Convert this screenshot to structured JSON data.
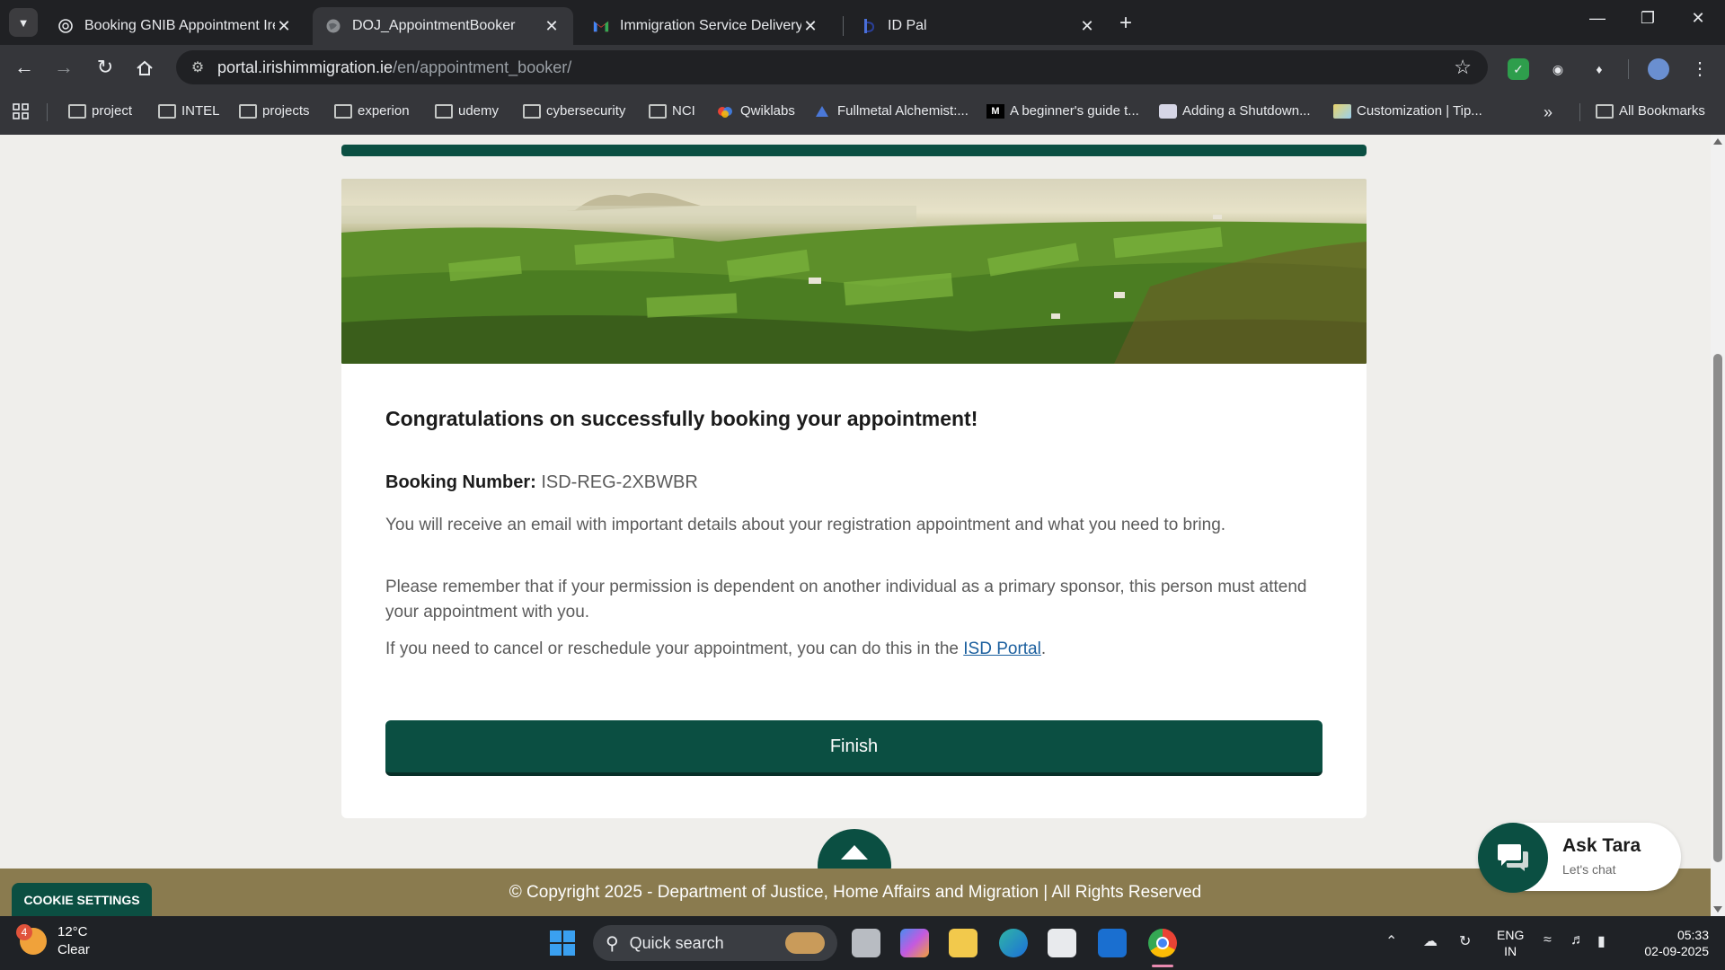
{
  "browser": {
    "tabs": [
      {
        "title": "Booking GNIB Appointment Ire",
        "icon": "openai-icon",
        "active": false
      },
      {
        "title": "DOJ_AppointmentBooker",
        "icon": "globe-icon",
        "active": true
      },
      {
        "title": "Immigration Service Delivery Re",
        "icon": "gmail-icon",
        "active": false
      },
      {
        "title": "ID Pal",
        "icon": "idpal-icon",
        "active": false
      }
    ],
    "url_host": "portal.irishimmigration.ie",
    "url_path": "/en/appointment_booker/",
    "bookmarks": [
      {
        "label": "project",
        "icon": "folder-icon"
      },
      {
        "label": "INTEL",
        "icon": "folder-icon"
      },
      {
        "label": "projects",
        "icon": "folder-icon"
      },
      {
        "label": "experion",
        "icon": "folder-icon"
      },
      {
        "label": "udemy",
        "icon": "folder-icon"
      },
      {
        "label": "cybersecurity",
        "icon": "folder-icon"
      },
      {
        "label": "NCI",
        "icon": "folder-icon"
      },
      {
        "label": "Qwiklabs",
        "icon": "qwiklabs-icon"
      },
      {
        "label": "Fullmetal Alchemist:...",
        "icon": "bookmark-site-icon"
      },
      {
        "label": "A beginner's guide t...",
        "icon": "medium-icon"
      },
      {
        "label": "Adding a Shutdown...",
        "icon": "bookmark-site-icon"
      },
      {
        "label": "Customization | Tip...",
        "icon": "bookmark-site-icon"
      }
    ],
    "all_bookmarks_label": "All Bookmarks"
  },
  "page": {
    "heading": "Congratulations on successfully booking your appointment!",
    "booking_label": "Booking Number:",
    "booking_number": "ISD-REG-2XBWBR",
    "para1": "You will receive an email with important details about your registration appointment and what you need to bring.",
    "para2": "Please remember that if your permission is dependent on another individual as a primary sponsor, this person must attend your appointment with you.",
    "para3_prefix": "If you need to cancel or reschedule your appointment, you can do this in the ",
    "para3_link": "ISD Portal",
    "para3_suffix": ".",
    "finish_label": "Finish",
    "footer_text": "© Copyright 2025 - Department of Justice, Home Affairs and Migration | All Rights Reserved",
    "cookie_label": "COOKIE SETTINGS",
    "chat_title": "Ask Tara",
    "chat_subtitle": "Let's chat",
    "colors": {
      "brand_green": "#0b4f42",
      "footer_olive": "#8a7b4f",
      "link_blue": "#1b5f9e"
    }
  },
  "taskbar": {
    "weather_temp": "12°C",
    "weather_desc": "Clear",
    "weather_badge": "4",
    "search_placeholder": "Quick search",
    "lang_line1": "ENG",
    "lang_line2": "IN",
    "time": "05:33",
    "date": "02-09-2025"
  }
}
